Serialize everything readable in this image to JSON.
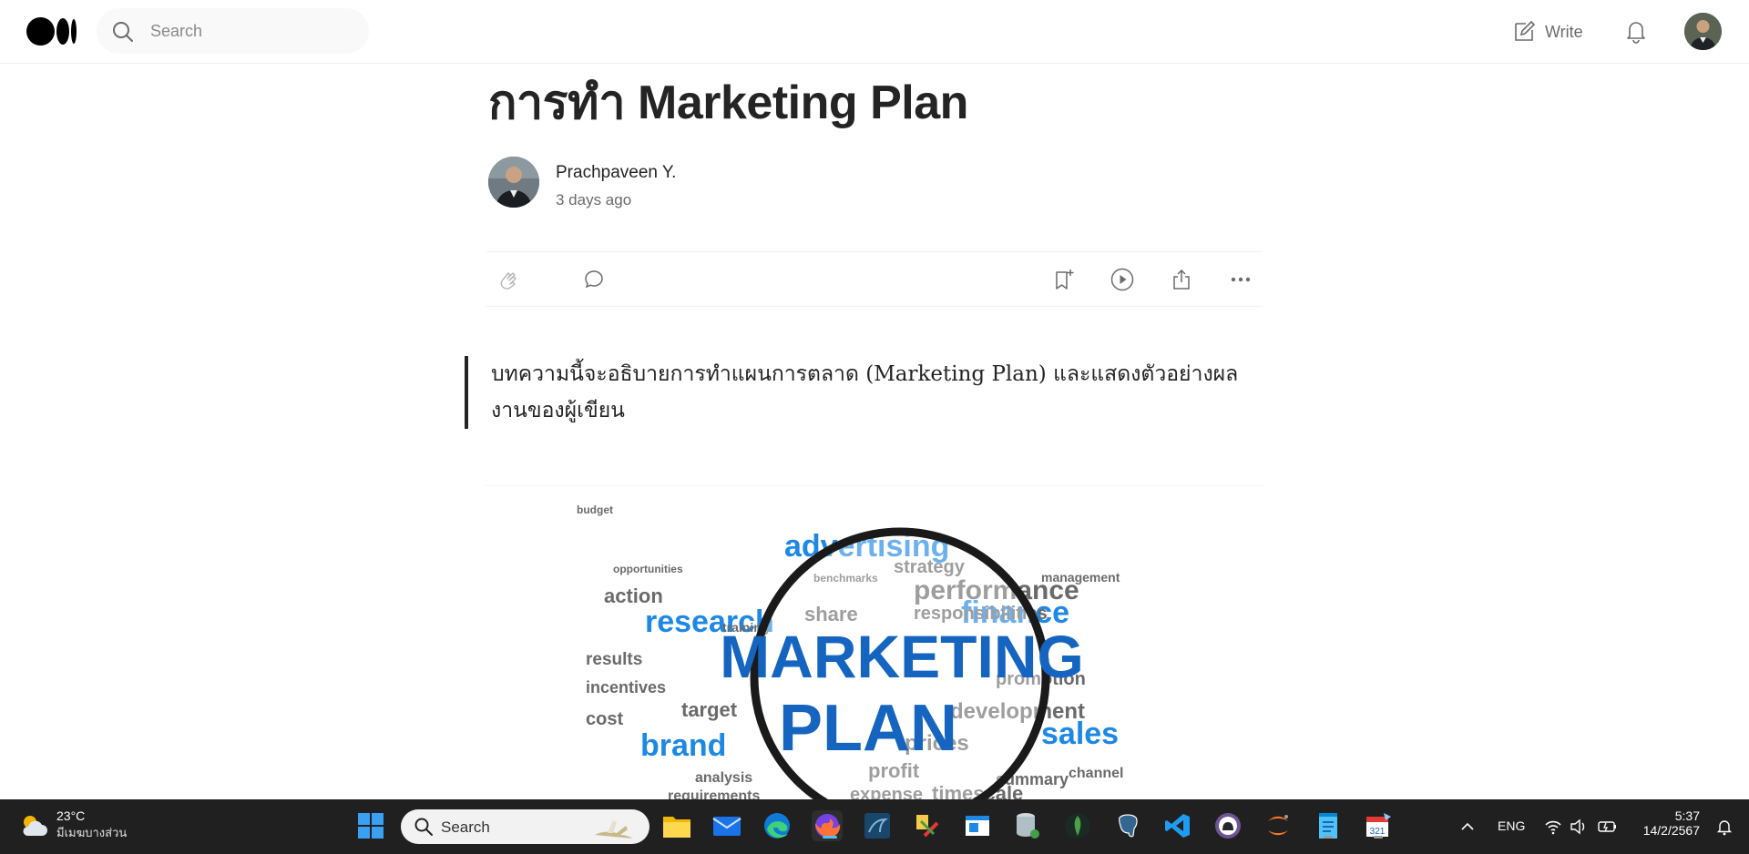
{
  "nav": {
    "search_placeholder": "Search",
    "write_label": "Write"
  },
  "article": {
    "title": "การทำ Marketing Plan",
    "author_name": "Prachpaveen Y.",
    "published": "3 days ago",
    "quote": "บทความนี้จะอธิบายการทำแผนการตลาด (Marketing Plan) และแสดงตัวอย่างผลงานของผู้เขียน"
  },
  "hero_image": {
    "center_words": [
      "MARKETING",
      "PLAN"
    ],
    "words": [
      "advertising",
      "strategy",
      "performance",
      "research",
      "finance",
      "responsibilities",
      "action",
      "training",
      "share",
      "results",
      "incentives",
      "promotion",
      "cost",
      "target",
      "development",
      "prices",
      "brand",
      "sales",
      "summary",
      "channel",
      "analysis",
      "profit",
      "expense",
      "timescale",
      "requirements",
      "management",
      "benchmarks",
      "opportunities",
      "budget"
    ]
  },
  "taskbar": {
    "weather_temp": "23°C",
    "weather_desc": "มีเมฆบางส่วน",
    "search_label": "Search",
    "language": "ENG",
    "time": "5:37",
    "date": "14/2/2567",
    "apps": [
      "windows-start",
      "file-explorer",
      "mail",
      "edge",
      "firefox",
      "mysql-workbench",
      "tool",
      "app-window",
      "database",
      "mongodb",
      "postgresql",
      "vscode",
      "github",
      "jupyter",
      "notepad",
      "calendar"
    ]
  },
  "colors": {
    "text_primary": "#242424",
    "text_secondary": "#6b6b6b",
    "taskbar_bg": "#202020",
    "word_blue": "#1e88e5",
    "word_gray": "#6a6a6a"
  }
}
